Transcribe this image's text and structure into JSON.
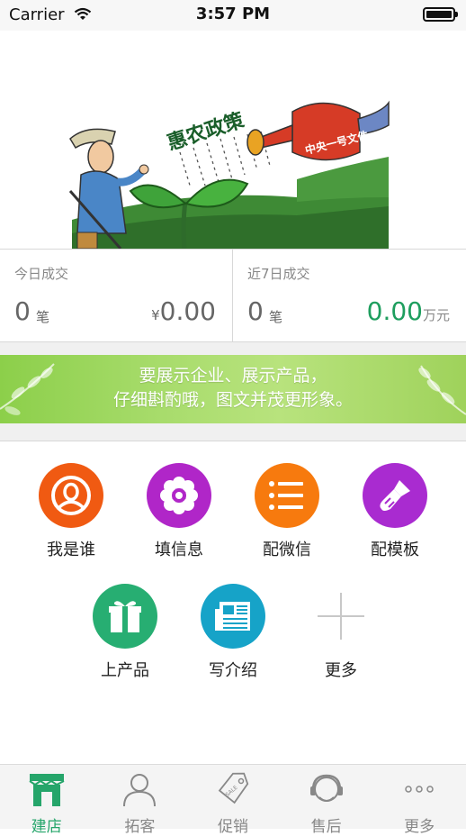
{
  "status_bar": {
    "carrier": "Carrier",
    "time": "3:57 PM"
  },
  "banner": {
    "image_text": "惠农政策",
    "kettle_text": "中央一号文件",
    "slides": 5,
    "active_slide": 3
  },
  "stats": {
    "today": {
      "title": "今日成交",
      "count": "0",
      "unit": "笔",
      "currency": "¥",
      "amount": "0.00"
    },
    "week": {
      "title": "近7日成交",
      "count": "0",
      "unit": "笔",
      "amount": "0.00",
      "amount_unit": "万元"
    }
  },
  "promo": {
    "line1": "要展示企业、展示产品，",
    "line2": "仔细斟酌哦，图文并茂更形象。"
  },
  "grid": {
    "items": [
      {
        "label": "我是谁",
        "icon": "user-icon",
        "color": "#f05a12"
      },
      {
        "label": "填信息",
        "icon": "flower-icon",
        "color": "#b026c8"
      },
      {
        "label": "配微信",
        "icon": "list-icon",
        "color": "#f77a0e"
      },
      {
        "label": "配模板",
        "icon": "brush-icon",
        "color": "#a92bd0"
      },
      {
        "label": "上产品",
        "icon": "gift-icon",
        "color": "#27ae72"
      },
      {
        "label": "写介绍",
        "icon": "newspaper-icon",
        "color": "#16a3c8"
      },
      {
        "label": "更多",
        "icon": "plus-icon",
        "color": "#cccccc"
      }
    ]
  },
  "tabbar": {
    "items": [
      {
        "label": "建店",
        "icon": "store-icon",
        "active": true
      },
      {
        "label": "拓客",
        "icon": "person-icon",
        "active": false
      },
      {
        "label": "促销",
        "icon": "tag-icon",
        "active": false
      },
      {
        "label": "售后",
        "icon": "headset-icon",
        "active": false
      },
      {
        "label": "更多",
        "icon": "more-icon",
        "active": false
      }
    ]
  },
  "colors": {
    "accent": "#25a56a",
    "amount_green": "#1e9e5e"
  }
}
